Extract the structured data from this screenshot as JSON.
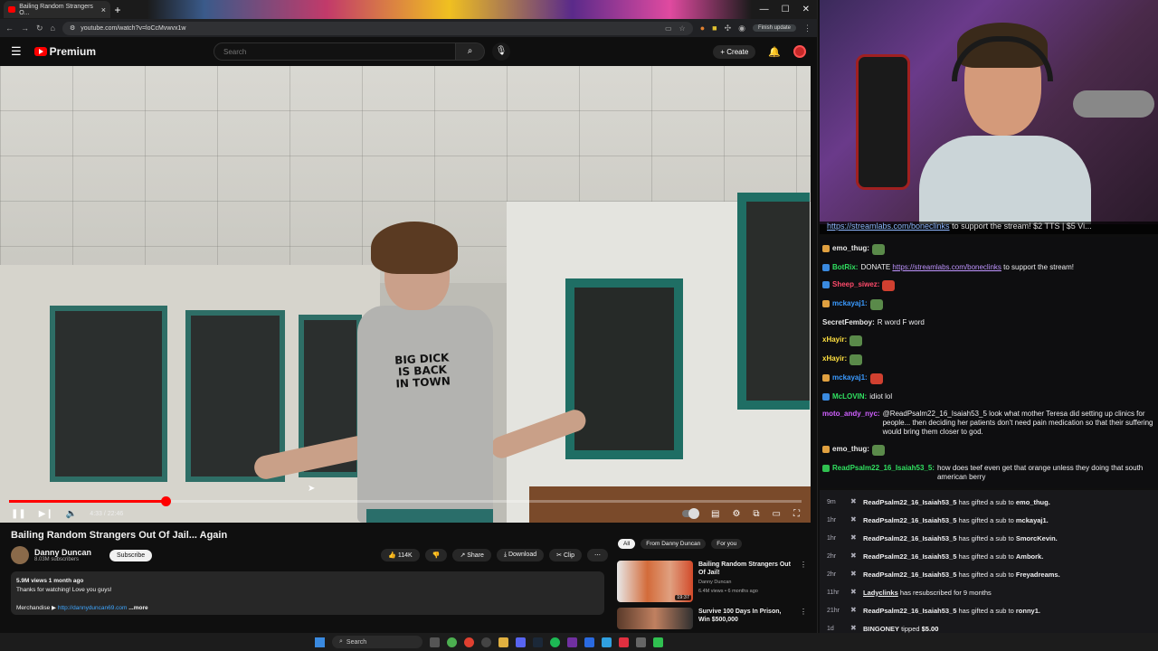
{
  "browser": {
    "tab_title": "Bailing Random Strangers O...",
    "url": "youtube.com/watch?v=loCcMvwvx1w",
    "finish_update": "Finish update"
  },
  "yt": {
    "logo": "Premium",
    "search_placeholder": "Search",
    "create": "Create"
  },
  "video": {
    "shirt_text": "BIG DICK IS BACK IN TOWN",
    "time": "4:33 / 22:46",
    "progress": 0.197,
    "title": "Bailing Random Strangers Out Of Jail... Again",
    "channel": "Danny Duncan",
    "subs": "8.03M subscribers",
    "subscribe": "Subscribe",
    "likes": "114K",
    "share": "Share",
    "download": "Download",
    "clip": "Clip",
    "desc_line1": "5.9M views  1 month ago",
    "desc_line2": "Thanks for watching! Love you guys!",
    "desc_merch": "Merchandise ▶",
    "desc_link": "http://dannyduncan69.com",
    "desc_more": "...more"
  },
  "related": {
    "chips": [
      "All",
      "From Danny Duncan",
      "For you"
    ],
    "items": [
      {
        "title": "Bailing Random Strangers Out Of Jail!",
        "channel": "Danny Duncan",
        "meta": "6.4M views • 6 months ago",
        "duration": "19:37"
      },
      {
        "title": "Survive 100 Days In Prison, Win $500,000",
        "channel": "",
        "meta": "",
        "duration": ""
      }
    ]
  },
  "stream": {
    "ticker_link": "https://streamlabs.com/boneclinks",
    "ticker_text": " to support the stream! $2 TTS | $5 Vi..."
  },
  "chat": [
    {
      "user": "emo_thug:",
      "color": "#e8e8e8",
      "text": "",
      "emote": "green",
      "badge": "orange"
    },
    {
      "user": "BotRix:",
      "color": "#30e060",
      "text": "DONATE ",
      "link": "https://streamlabs.com/boneclinks",
      "after": " to support the stream!",
      "badge": "blue"
    },
    {
      "user": "Sheep_siwez:",
      "color": "#ff4a6a",
      "text": "",
      "emote": "red",
      "badge": "blue"
    },
    {
      "user": "mckayaj1:",
      "color": "#3a9aff",
      "text": "",
      "emote": "green",
      "badge": "orange"
    },
    {
      "user": "SecretFemboy:",
      "color": "#e8e8e8",
      "text": "R word F word",
      "badge": ""
    },
    {
      "user": "xHayir:",
      "color": "#ffe040",
      "text": "",
      "emote": "green",
      "badge": ""
    },
    {
      "user": "xHayir:",
      "color": "#ffe040",
      "text": "",
      "emote": "green",
      "badge": ""
    },
    {
      "user": "mckayaj1:",
      "color": "#3a9aff",
      "text": "",
      "emote": "red",
      "badge": "orange"
    },
    {
      "user": "McLOVIN:",
      "color": "#30e060",
      "text": "idiot lol",
      "badge": "blue"
    },
    {
      "user": "moto_andy_nyc:",
      "color": "#d060ff",
      "text": "@ReadPsalm22_16_Isaiah53_5 look what mother Teresa did setting up clinics for people... then deciding her patients don't need pain medication so that their suffering would bring them closer to god.",
      "badge": ""
    },
    {
      "user": "emo_thug:",
      "color": "#e8e8e8",
      "text": "",
      "emote": "green",
      "badge": "orange"
    },
    {
      "user": "ReadPsalm22_16_Isaiah53_5:",
      "color": "#30e060",
      "text": "how does teef even get that orange unless they doing that south american berry",
      "badge": "green"
    }
  ],
  "feed": [
    {
      "time": "9m",
      "user": "ReadPsalm22_16_Isaiah53_5",
      "mid": " has gifted a sub to ",
      "target": "emo_thug."
    },
    {
      "time": "1hr",
      "user": "ReadPsalm22_16_Isaiah53_5",
      "mid": " has gifted a sub to ",
      "target": "mckayaj1."
    },
    {
      "time": "1hr",
      "user": "ReadPsalm22_16_Isaiah53_5",
      "mid": " has gifted a sub to ",
      "target": "SmorcKevin."
    },
    {
      "time": "2hr",
      "user": "ReadPsalm22_16_Isaiah53_5",
      "mid": " has gifted a sub to ",
      "target": "Ambork."
    },
    {
      "time": "2hr",
      "user": "ReadPsalm22_16_Isaiah53_5",
      "mid": " has gifted a sub to ",
      "target": "Freyadreams."
    },
    {
      "time": "11hr",
      "user": "Ladyclinks",
      "mid": " has resubscribed for 9 months",
      "target": ""
    },
    {
      "time": "21hr",
      "user": "ReadPsalm22_16_Isaiah53_5",
      "mid": " has gifted a sub to ",
      "target": "ronny1."
    },
    {
      "time": "1d",
      "user": "BINGONEY",
      "mid": " tipped ",
      "target": "$5.00"
    }
  ],
  "feed_sub": "https://youtu.be/hqDinxaPUK4?si=M3rS00_DELuCs5d1",
  "taskbar": {
    "search": "Search"
  }
}
